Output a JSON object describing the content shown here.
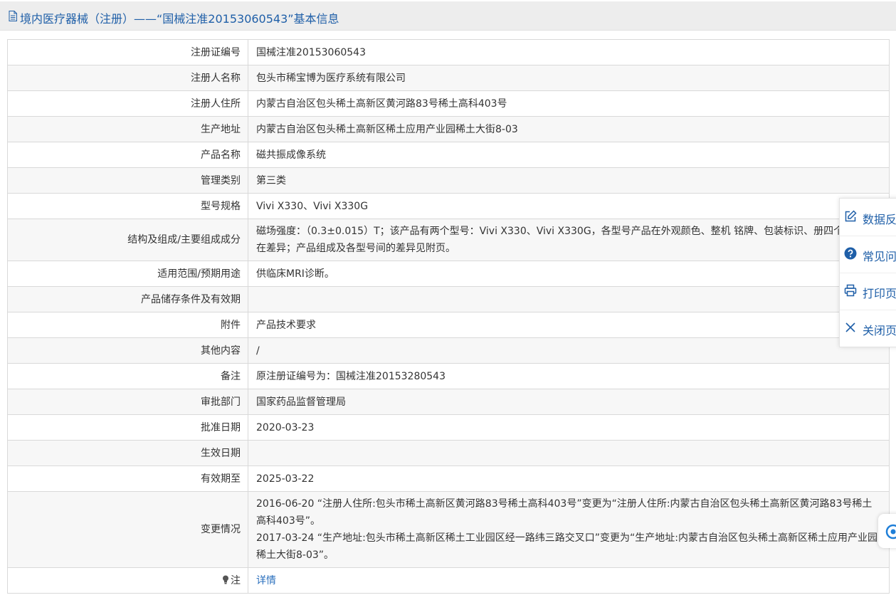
{
  "header": {
    "title": "境内医疗器械（注册）——“国械注准20153060543”基本信息",
    "icon": "document-icon"
  },
  "rows": [
    {
      "label": "注册证编号",
      "value": "国械注准20153060543"
    },
    {
      "label": "注册人名称",
      "value": "包头市稀宝博为医疗系统有限公司"
    },
    {
      "label": "注册人住所",
      "value": "内蒙古自治区包头稀土高新区黄河路83号稀土高科403号"
    },
    {
      "label": "生产地址",
      "value": "内蒙古自治区包头稀土高新区稀土应用产业园稀土大街8-03"
    },
    {
      "label": "产品名称",
      "value": "磁共振成像系统"
    },
    {
      "label": "管理类别",
      "value": "第三类"
    },
    {
      "label": "型号规格",
      "value": "Vivi X330、Vivi X330G"
    },
    {
      "label": "结构及组成/主要组成成分",
      "value": "磁场强度：（0.3±0.015）T；该产品有两个型号：Vivi X330、Vivi X330G，各型号产品在外观颜色、整机 铭牌、包装标识、册四个方面存在差异；产品组成及各型号间的差异见附页。"
    },
    {
      "label": "适用范围/预期用途",
      "value": "供临床MRI诊断。"
    },
    {
      "label": "产品储存条件及有效期",
      "value": ""
    },
    {
      "label": "附件",
      "value": "产品技术要求"
    },
    {
      "label": "其他内容",
      "value": "/"
    },
    {
      "label": "备注",
      "value": "原注册证编号为：国械注准20153280543"
    },
    {
      "label": "审批部门",
      "value": "国家药品监督管理局"
    },
    {
      "label": "批准日期",
      "value": "2020-03-23"
    },
    {
      "label": "生效日期",
      "value": ""
    },
    {
      "label": "有效期至",
      "value": "2025-03-22"
    },
    {
      "label": "变更情况",
      "value_lines": [
        "2016-06-20 “注册人住所:包头市稀土高新区黄河路83号稀土高科403号”变更为“注册人住所:内蒙古自治区包头稀土高新区黄河路83号稀土高科403号”。",
        "2017-03-24 “生产地址:包头市稀土高新区稀土工业园区经一路纬三路交叉口”变更为“生产地址:内蒙古自治区包头稀土高新区稀土应用产业园稀土大街8-03”。"
      ]
    },
    {
      "label": "注",
      "value": "详情"
    }
  ],
  "side_panel": {
    "items": [
      {
        "label": "数据反",
        "icon": "edit-icon"
      },
      {
        "label": "常见问",
        "icon": "help-circle-icon"
      },
      {
        "label": "打印页",
        "icon": "printer-icon"
      },
      {
        "label": "关闭页",
        "icon": "close-icon"
      }
    ]
  },
  "colors": {
    "accent": "#1f5fa8",
    "link": "#2a6fbd",
    "header_bg": "#ededed",
    "row_alt_bg": "#f7f7f7",
    "border": "#d9d9d9"
  }
}
